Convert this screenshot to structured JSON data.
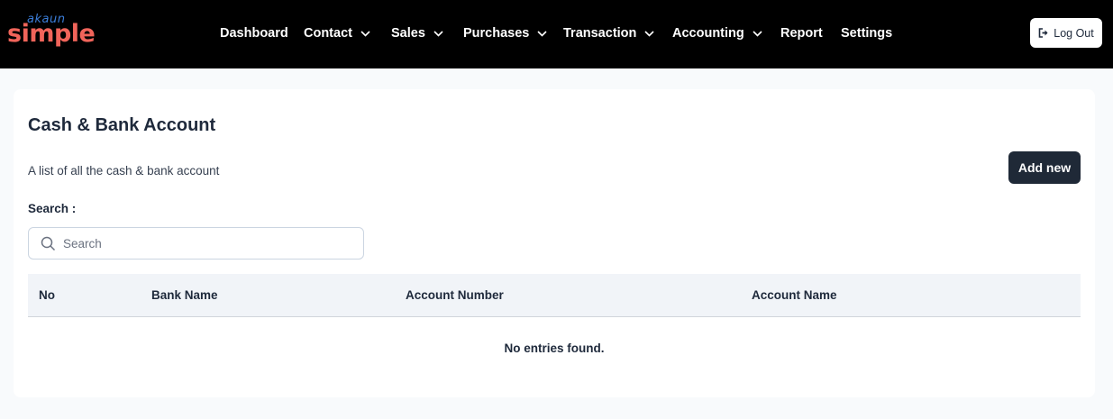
{
  "logo": {
    "small_text": "akaun",
    "big_text": "simple"
  },
  "nav": {
    "items": [
      {
        "label": "Dashboard",
        "has_dropdown": false
      },
      {
        "label": "Contact",
        "has_dropdown": true
      },
      {
        "label": "Sales",
        "has_dropdown": true
      },
      {
        "label": "Purchases",
        "has_dropdown": true
      },
      {
        "label": "Transaction",
        "has_dropdown": true
      },
      {
        "label": "Accounting",
        "has_dropdown": true
      },
      {
        "label": "Report",
        "has_dropdown": false
      },
      {
        "label": "Settings",
        "has_dropdown": false
      }
    ],
    "logout_label": "Log Out"
  },
  "page": {
    "title": "Cash & Bank Account",
    "description": "A list of all the cash & bank account",
    "add_button_label": "Add new"
  },
  "search": {
    "label": "Search :",
    "placeholder": "Search",
    "value": ""
  },
  "table": {
    "columns": [
      "No",
      "Bank Name",
      "Account Number",
      "Account Name"
    ],
    "rows": [],
    "empty_message": "No entries found."
  },
  "colors": {
    "topbar_bg": "#000000",
    "logo_primary": "#f0645a",
    "logo_secondary": "#3b7dd8",
    "button_dark": "#1f2937",
    "table_header_bg": "#f1f4f8"
  }
}
